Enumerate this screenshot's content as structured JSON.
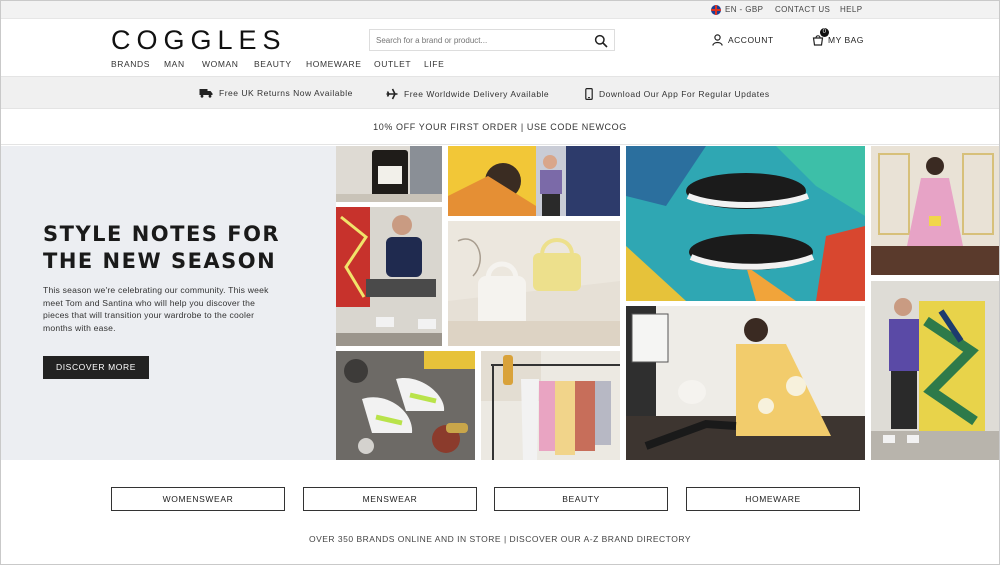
{
  "utility": {
    "locale": "EN - GBP",
    "contact": "CONTACT US",
    "help": "HELP"
  },
  "header": {
    "logo": "COGGLES",
    "search_placeholder": "Search for a brand or product...",
    "account": "ACCOUNT",
    "bag": "MY BAG",
    "bag_count": "0"
  },
  "nav": [
    "BRANDS",
    "MAN",
    "WOMAN",
    "BEAUTY",
    "HOMEWARE",
    "OUTLET",
    "LIFE"
  ],
  "usp": {
    "returns": "Free UK Returns Now Available",
    "delivery": "Free Worldwide Delivery Available",
    "app": "Download Our App For Regular Updates"
  },
  "promo": "10% OFF YOUR FIRST ORDER | USE CODE NEWCOG",
  "hero": {
    "title_line1": "STYLE NOTES FOR",
    "title_line2": "THE NEW SEASON",
    "body": "This season we're celebrating our community. This week meet Tom and Santina who will help you discover the pieces that will transition your wardrobe to the cooler months with ease.",
    "cta": "DISCOVER MORE"
  },
  "categories": [
    "WOMENSWEAR",
    "MENSWEAR",
    "BEAUTY",
    "HOMEWARE"
  ],
  "brands_line": "OVER 350 BRANDS ONLINE AND IN STORE | DISCOVER OUR A-Z BRAND DIRECTORY",
  "colors": {
    "dark": "#222222",
    "strip": "#f0f0f0",
    "hero_bg": "#eceef2"
  }
}
